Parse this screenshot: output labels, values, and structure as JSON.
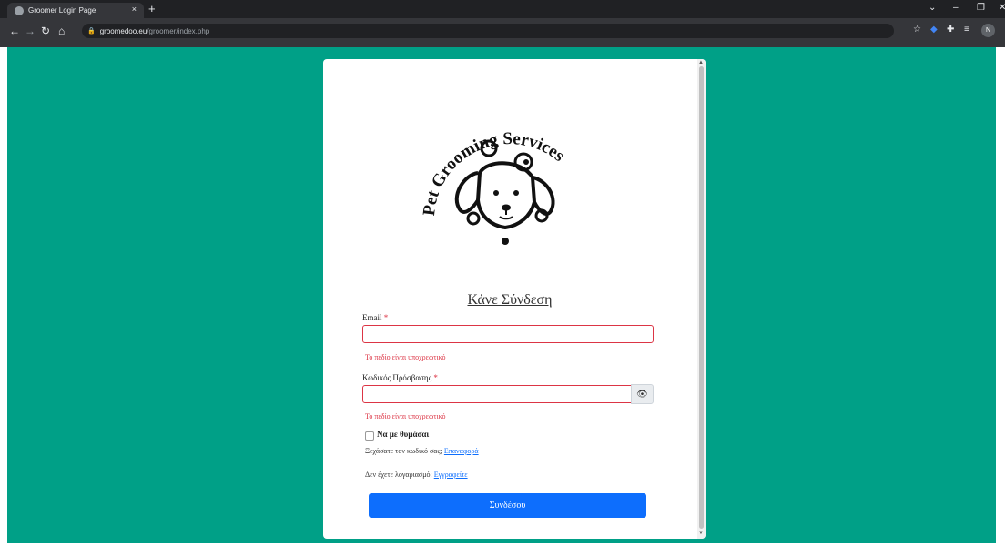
{
  "browser": {
    "tab_title": "Groomer Login Page",
    "tab_close": "×",
    "new_tab": "+",
    "url_domain": "groomedoo.eu",
    "url_path": "/groomer/index.php",
    "profile_initial": "N"
  },
  "logo": {
    "text": "Pet Grooming Services"
  },
  "login": {
    "title": "Κάνε Σύνδεση",
    "email_label": "Email",
    "required_mark": "*",
    "email_error": "Το πεδίο είναι υποχρεωτικό",
    "password_label": "Κωδικός Πρόσβασης",
    "password_error": "Το πεδίο είναι υποχρεωτικό",
    "remember_label": "Να με θυμάσαι",
    "forgot_text": "Ξεχάσατε τον κωδικό σας;",
    "forgot_link": "Επαναφορά",
    "no_account_text": "Δεν έχετε λογαριασμό;",
    "register_link": "Εγγραφείτε",
    "submit_label": "Συνδέσου"
  },
  "colors": {
    "page_background": "#00a087",
    "primary": "#0d6efd",
    "error": "#dc3545"
  }
}
